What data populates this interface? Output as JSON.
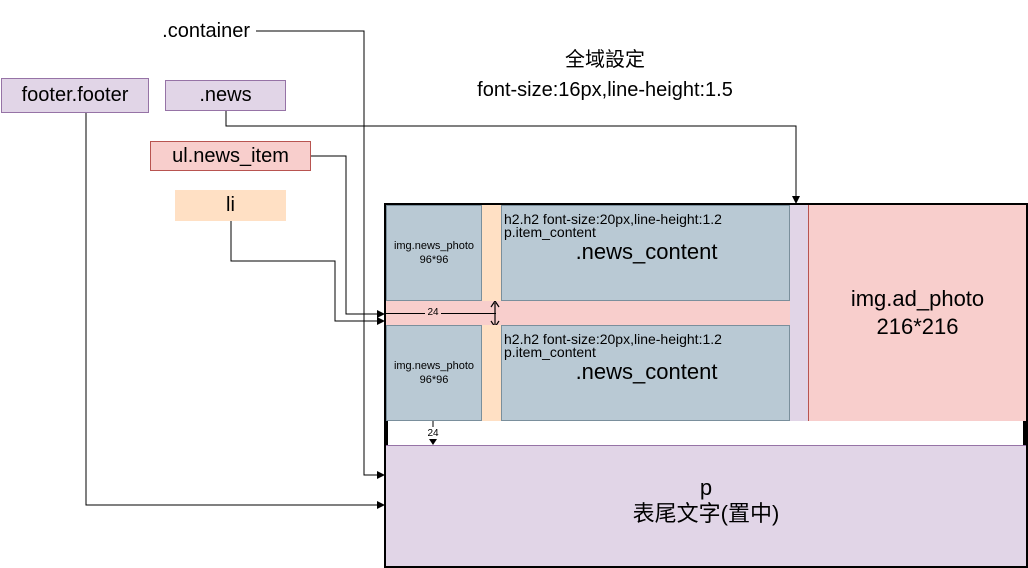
{
  "labels": {
    "container": ".container",
    "footer": "footer.footer",
    "news": ".news",
    "news_item": "ul.news_item",
    "li": "li"
  },
  "global": {
    "title": "全域設定",
    "value": "font-size:16px,line-height:1.5"
  },
  "items": [
    {
      "photo_label": "img.news_photo",
      "photo_size": "96*96",
      "h2_text": "h2.h2  font-size:20px,line-height:1.2",
      "p_text": "p.item_content",
      "content_title": ".news_content"
    },
    {
      "photo_label": "img.news_photo",
      "photo_size": "96*96",
      "h2_text": "h2.h2  font-size:20px,line-height:1.2",
      "p_text": "p.item_content",
      "content_title": ".news_content"
    }
  ],
  "gap_label_1": "24",
  "gap_label_2": "24",
  "ad": {
    "name": "img.ad_photo",
    "size": "216*216"
  },
  "footer_box": {
    "tag": "p",
    "text": "表尾文字(置中)"
  },
  "colors": {
    "blue_gray": "#b9c9d4",
    "peach": "#ffe0c4",
    "pink": "#f8cecc",
    "lavender": "#e1d5e7",
    "pink_border": "#b85450",
    "lavender_border": "#9673a6"
  }
}
